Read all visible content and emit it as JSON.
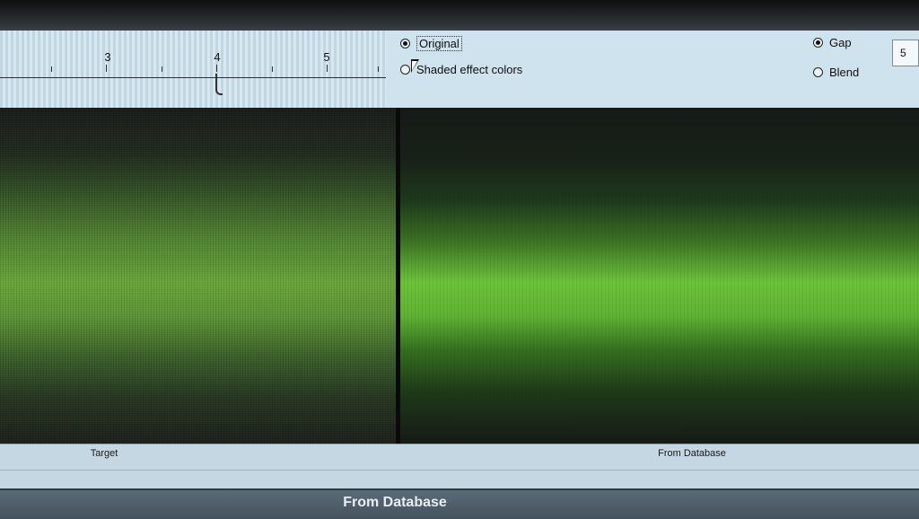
{
  "ruler": {
    "labels": [
      "3",
      "4",
      "5"
    ]
  },
  "options": {
    "original_label": "Original",
    "shaded_label": "Shaded effect colors",
    "gap_label": "Gap",
    "blend_label": "Blend",
    "value": "5"
  },
  "captions": {
    "left": "Target",
    "right": "From Database"
  },
  "status": {
    "title": "From Database"
  }
}
